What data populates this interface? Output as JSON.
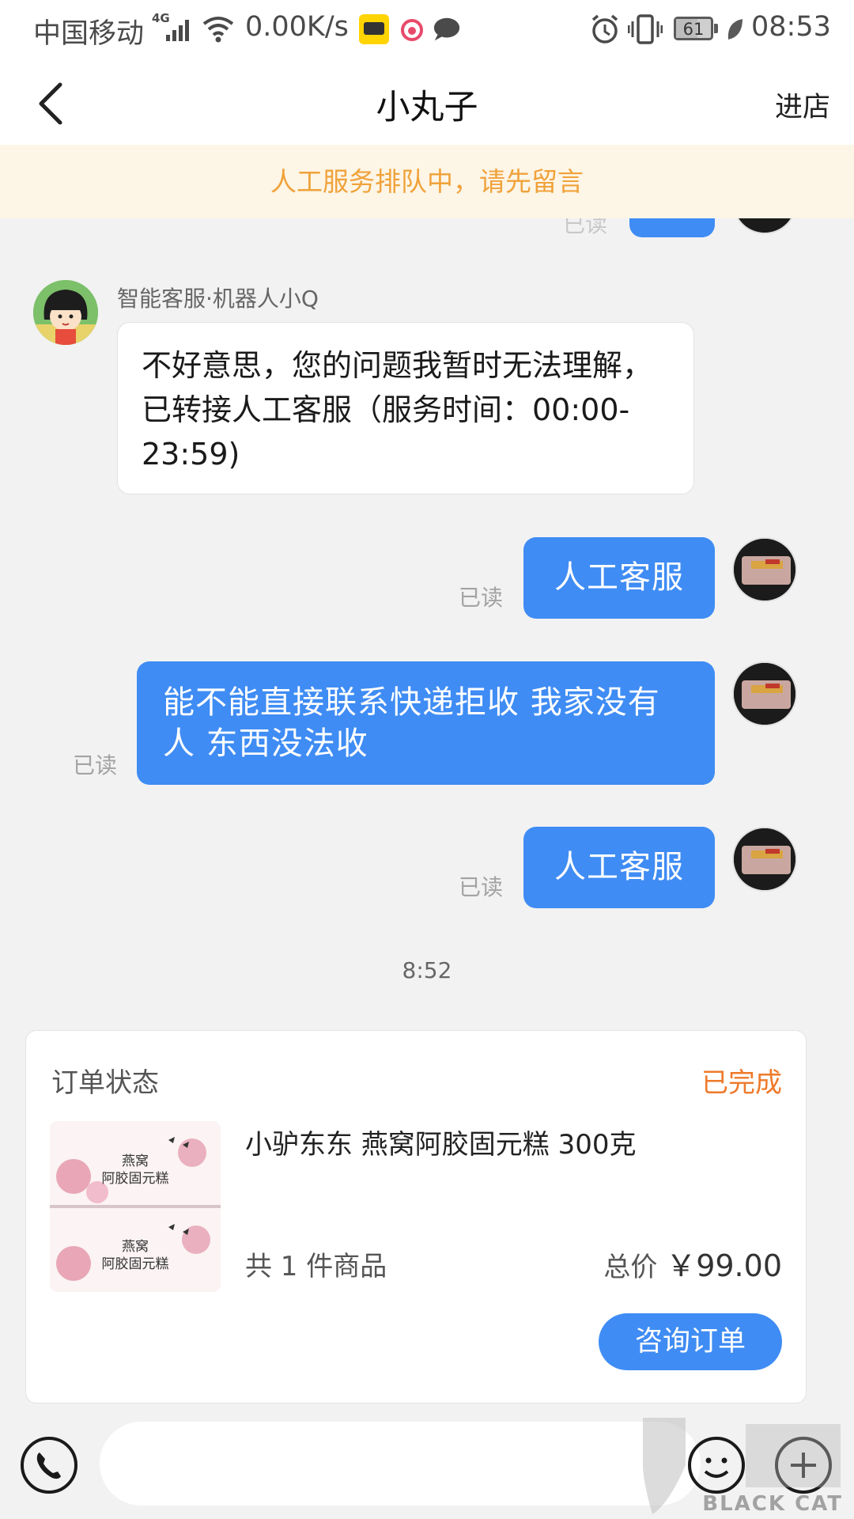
{
  "status_bar": {
    "carrier": "中国移动",
    "network": "4G",
    "speed": "0.00K/s",
    "app_icons": [
      "xianyu-icon",
      "weibo-icon",
      "message-icon"
    ],
    "battery": "61",
    "battery_level": 0.61,
    "time": "08:53"
  },
  "nav": {
    "title": "小丸子",
    "right_label": "进店"
  },
  "notice": "人工服务排队中，请先留言",
  "chat": {
    "partial_read": "已读",
    "bot_sender": "智能客服·机器人小Q",
    "bot_message": "不好意思，您的问题我暂时无法理解，已转接人工客服（服务时间：00:00-23:59)",
    "messages": [
      {
        "text": "人工客服",
        "read": "已读"
      },
      {
        "text": "能不能直接联系快递拒收 我家没有人 东西没法收",
        "read": "已读"
      },
      {
        "text": "人工客服",
        "read": "已读"
      }
    ],
    "timestamp": "8:52"
  },
  "order": {
    "title": "订单状态",
    "status": "已完成",
    "product_name": "小驴东东 燕窝阿胶固元糕 300克",
    "thumbnail_text": "燕窝\n阿胶固元糕",
    "quantity": "共 1 件商品",
    "total_label": "总价",
    "total_price": "￥99.00",
    "button": "咨询订单"
  },
  "colors": {
    "accent": "#3f8cf4",
    "notice_text": "#f0a23a",
    "notice_bg": "#fdf5e6",
    "status_done": "#ee7a2b"
  },
  "watermark": "BLACK CAT"
}
